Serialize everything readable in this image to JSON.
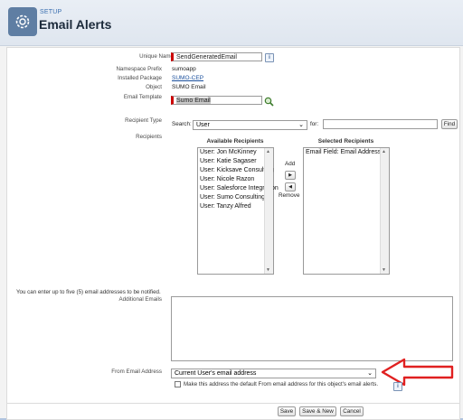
{
  "header": {
    "setup_label": "SETUP",
    "title": "Email Alerts",
    "icon": "gear-icon"
  },
  "fields": {
    "unique_name_label": "Unique Name",
    "unique_name_value": "SendGeneratedEmail",
    "namespace_label": "Namespace Prefix",
    "namespace_value": "sumoapp",
    "package_label": "Installed Package",
    "package_value": "SUMO-CEP",
    "object_label": "Object",
    "object_value": "SUMO Email",
    "template_label": "Email Template",
    "template_value": "Sumo Email"
  },
  "recipients": {
    "type_label": "Recipient Type",
    "search_label": "Search:",
    "search_value": "User",
    "for_label": "for:",
    "for_value": "",
    "find_button": "Find",
    "recipients_label": "Recipients",
    "available_header": "Available Recipients",
    "available": [
      "User: Jon McKinney",
      "User: Katie Sagaser",
      "User: Kicksave Consulting",
      "User: Nicole Razon",
      "User: Salesforce Integration",
      "User: Sumo Consulting",
      "User: Tanzy Alfred"
    ],
    "add_label": "Add",
    "remove_label": "Remove",
    "add_arrow": "▶",
    "remove_arrow": "◀",
    "selected_header": "Selected Recipients",
    "selected": [
      "Email Field: Email Address"
    ]
  },
  "additional": {
    "note": "You can enter up to five (5) email addresses to be notified.",
    "label": "Additional Emails",
    "value": ""
  },
  "from": {
    "label": "From Email Address",
    "value": "Current User's email address",
    "checkbox_label": "Make this address the default From email address for this object's email alerts.",
    "checkbox_checked": false
  },
  "buttons": {
    "save": "Save",
    "save_new": "Save & New",
    "cancel": "Cancel"
  },
  "colors": {
    "annotation_arrow": "#e02020",
    "required_bar": "#cc0000",
    "header_icon_bg": "#5f7ea3"
  }
}
